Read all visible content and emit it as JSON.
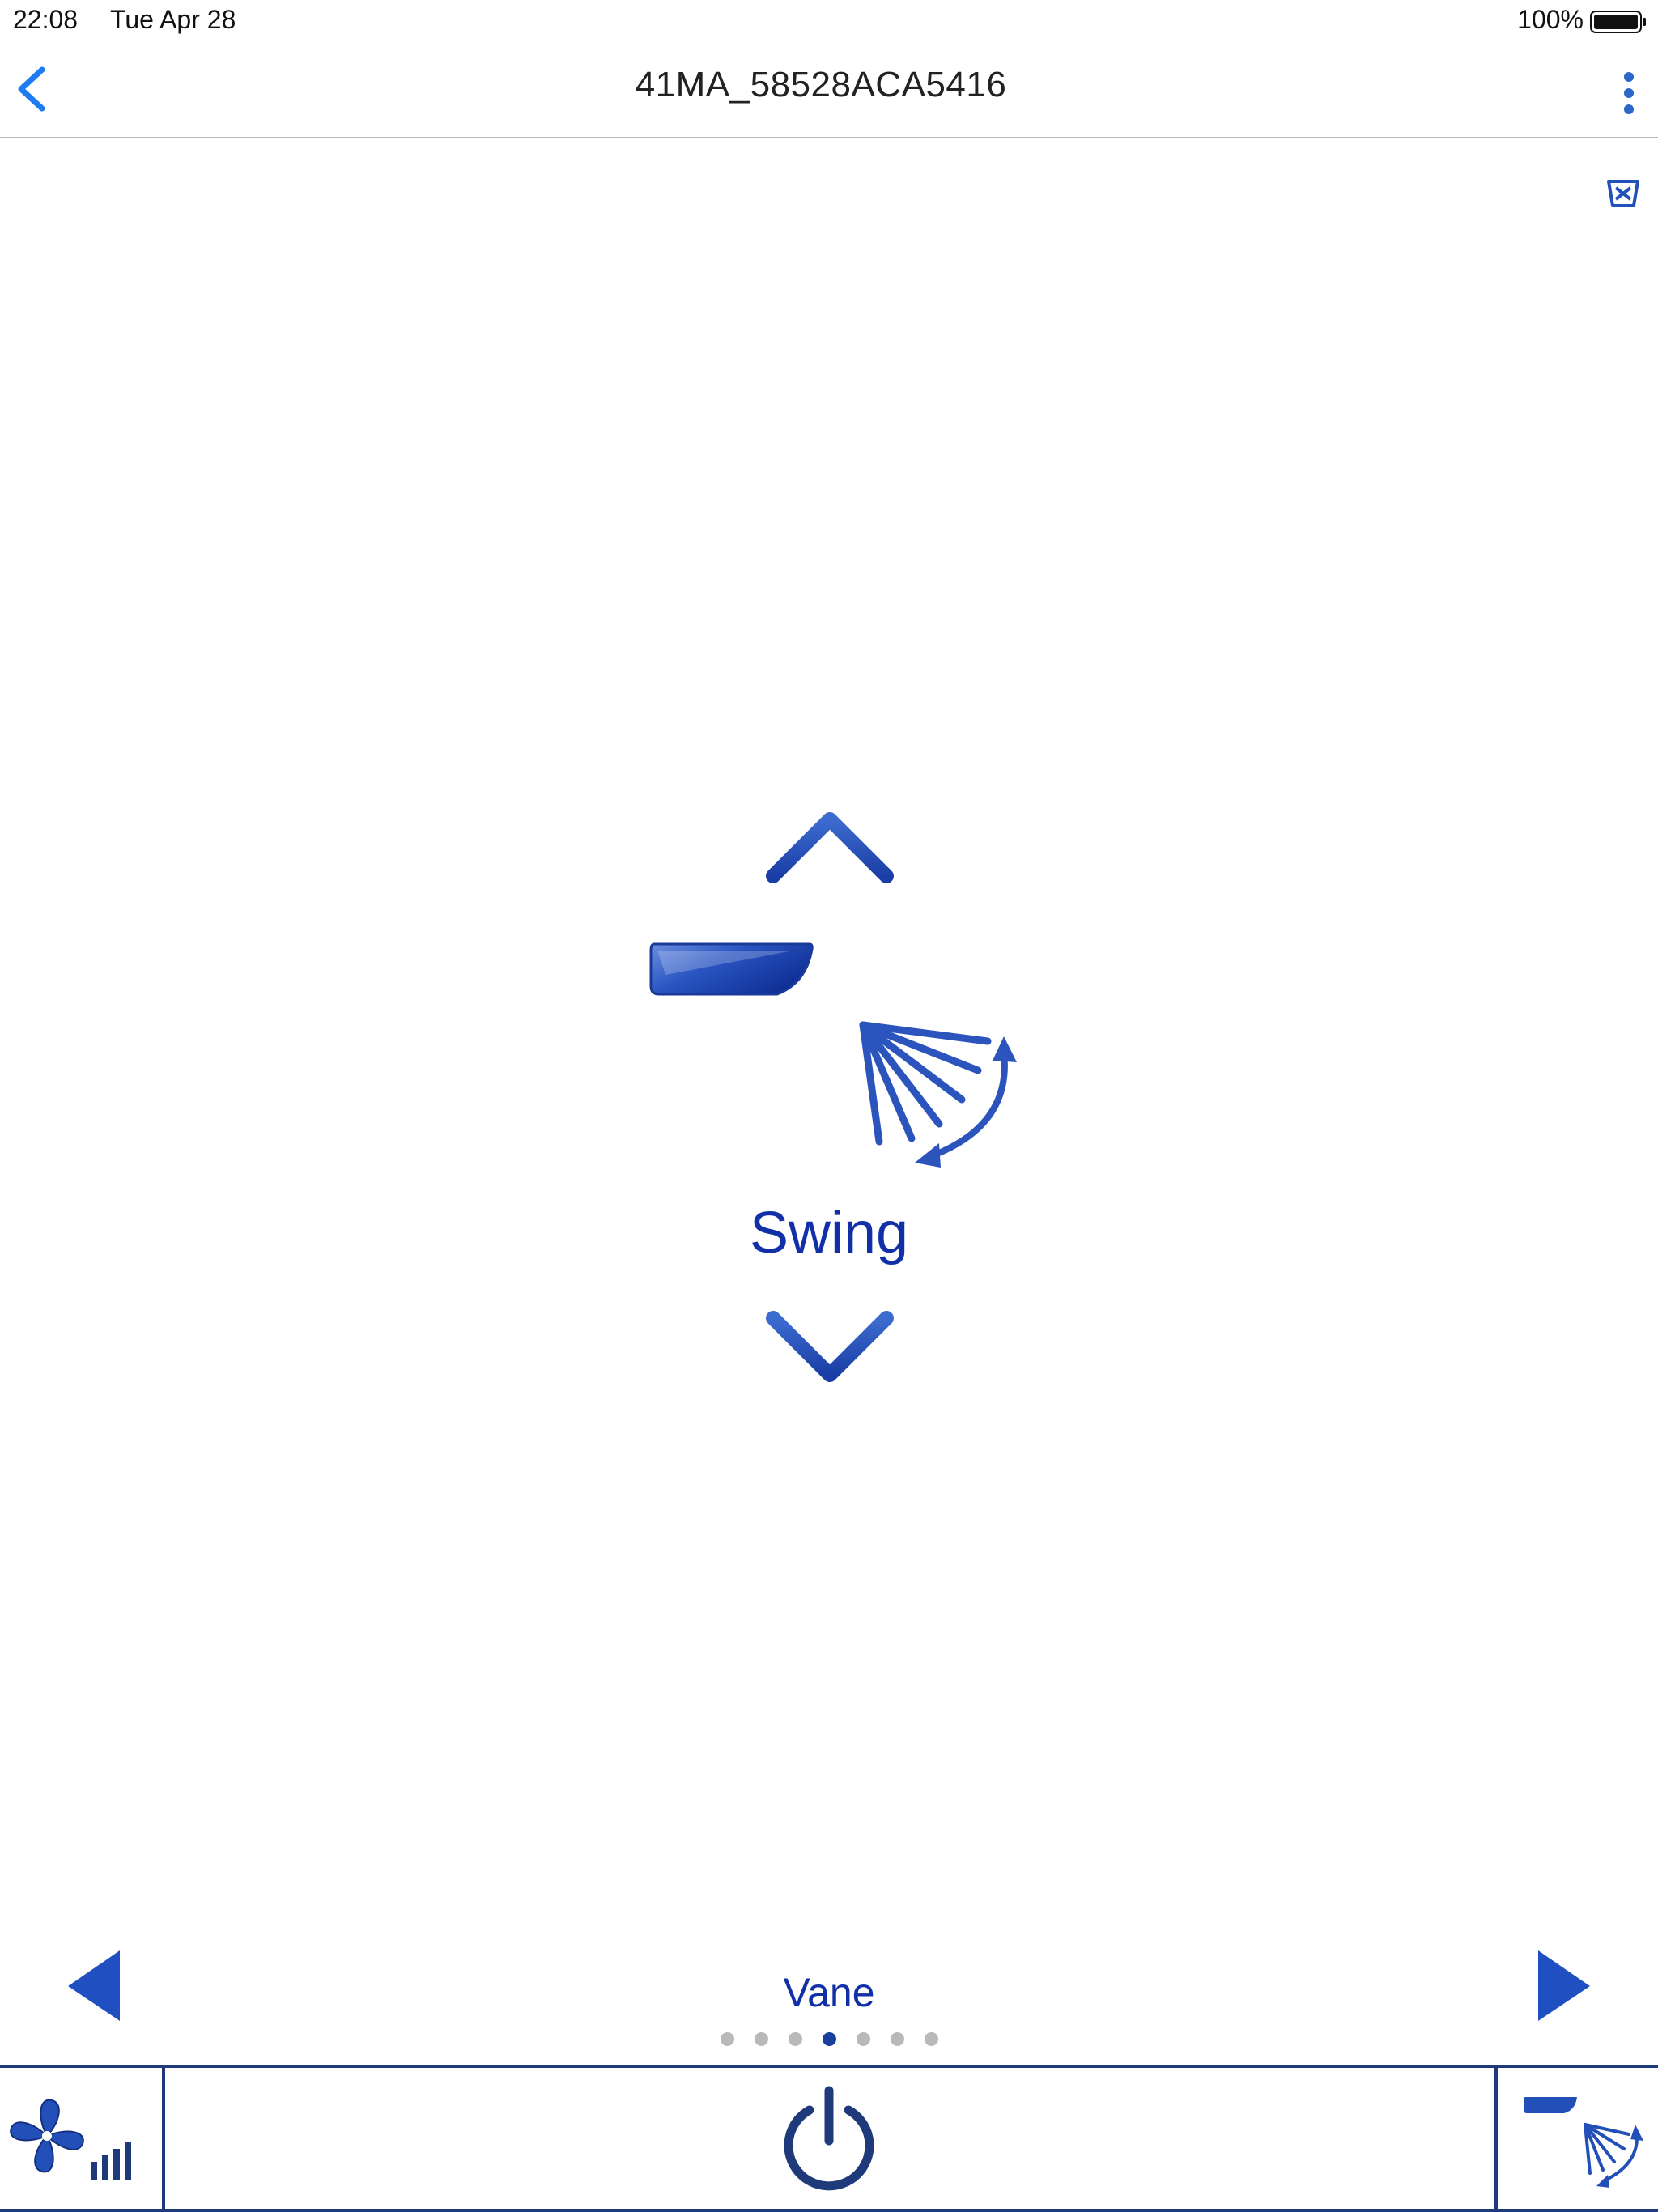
{
  "status_bar": {
    "time": "22:08",
    "date": "Tue Apr 28",
    "battery": "100%"
  },
  "nav": {
    "title": "41MA_58528ACA5416"
  },
  "control": {
    "mode_label": "Swing",
    "page_label": "Vane",
    "pages_total": 7,
    "active_page_index": 3
  },
  "icons": {
    "back": "chevron-left-icon",
    "more": "more-vertical-icon",
    "remote": "remote-icon",
    "up": "chevron-up-icon",
    "down": "chevron-down-icon",
    "vane": "vane-icon",
    "swing": "swing-icon",
    "prev": "triangle-left-icon",
    "next": "triangle-right-icon",
    "fan": "fan-speed-icon",
    "power": "power-icon",
    "vane_swing": "vane-swing-icon"
  },
  "colors": {
    "ios_blue": "#1e7cf2",
    "app_blue": "#1130a8",
    "icon_blue": "#2350b8",
    "toolbar_navy": "#1f3a7a"
  }
}
